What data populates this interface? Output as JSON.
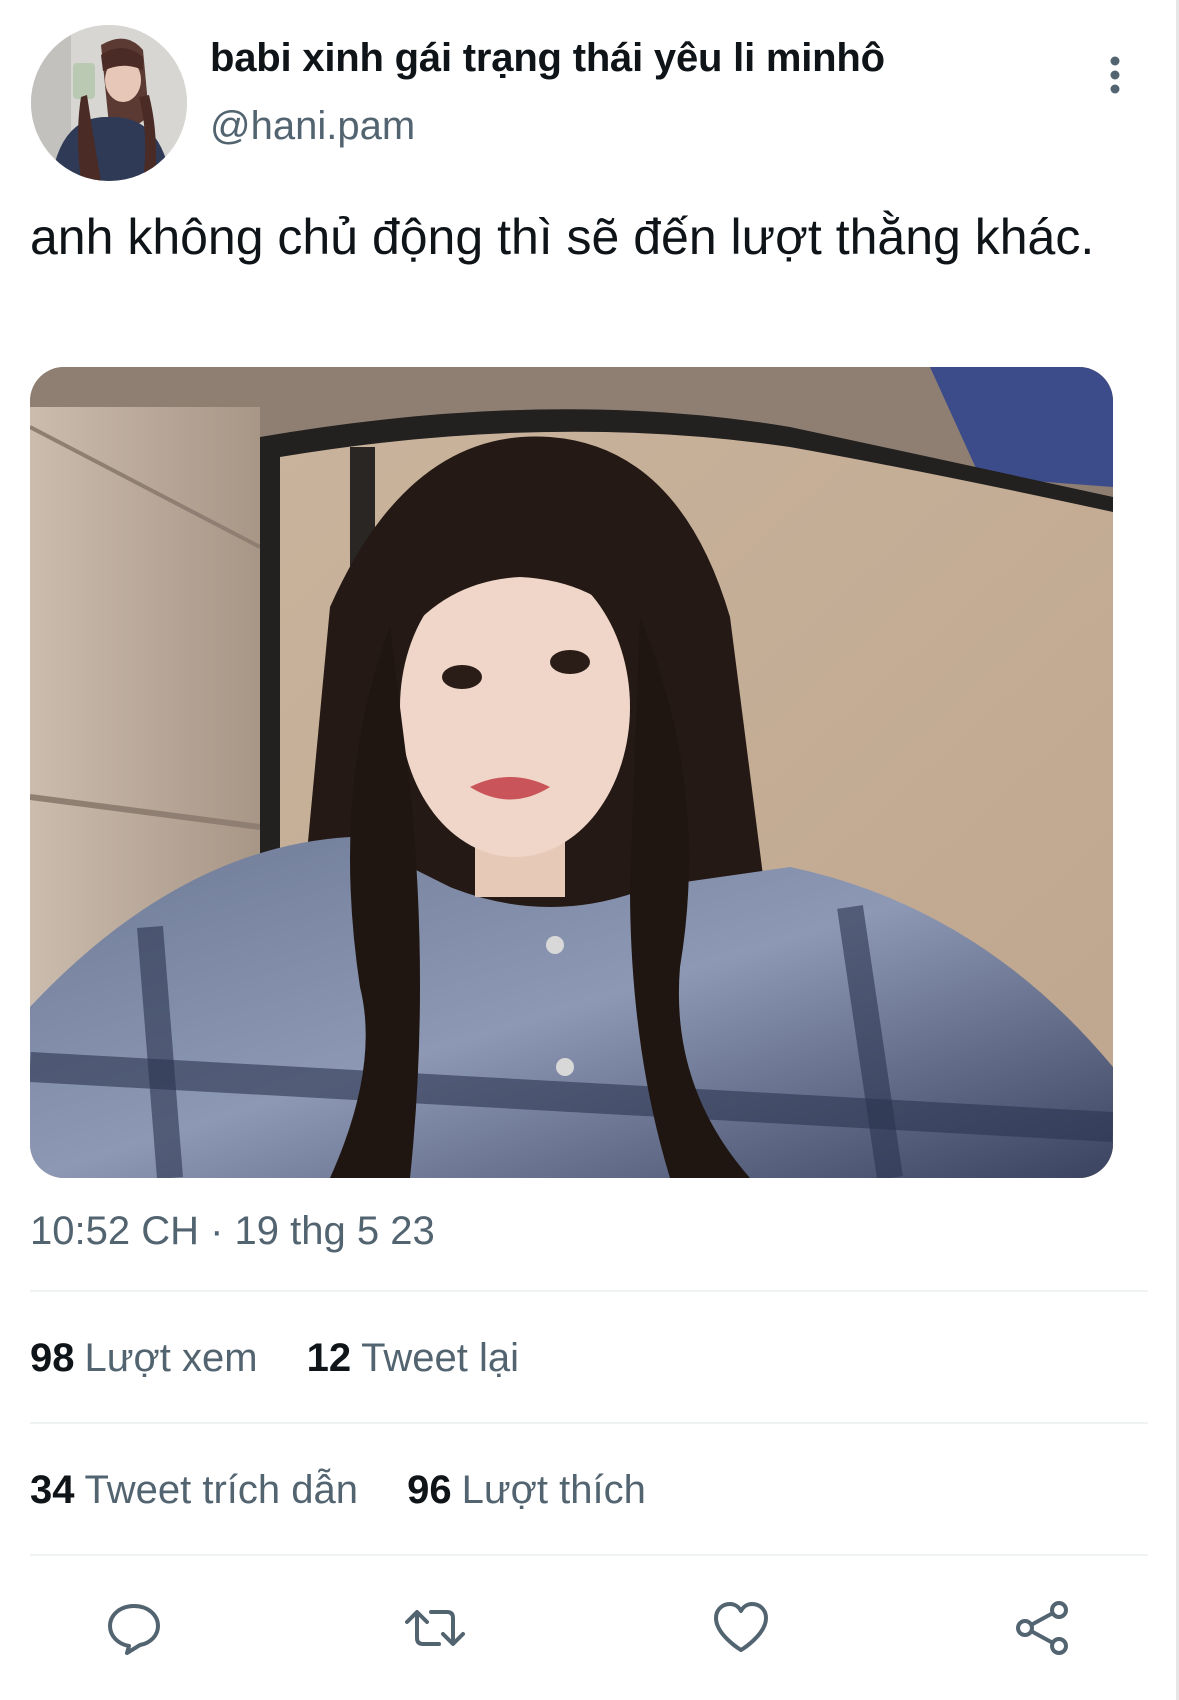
{
  "author": {
    "display_name": "babi xinh gái trạng thái yêu li minhô",
    "handle": "@hani.pam"
  },
  "tweet": {
    "text": "anh không chủ động thì sẽ đến lượt thằng khác.",
    "timestamp": "10:52 CH · 19 thg 5 23"
  },
  "stats": {
    "views": {
      "count": "98",
      "label": "Lượt xem"
    },
    "retweets": {
      "count": "12",
      "label": "Tweet lại"
    },
    "quotes": {
      "count": "34",
      "label": "Tweet trích dẫn"
    },
    "likes": {
      "count": "96",
      "label": "Lượt thích"
    }
  },
  "actions": {
    "reply": "reply-icon",
    "retweet": "retweet-icon",
    "like": "heart-icon",
    "share": "share-icon"
  },
  "colors": {
    "primary_text": "#0f1419",
    "secondary_text": "#536471",
    "divider": "#eff3f4",
    "icon": "#536471"
  }
}
